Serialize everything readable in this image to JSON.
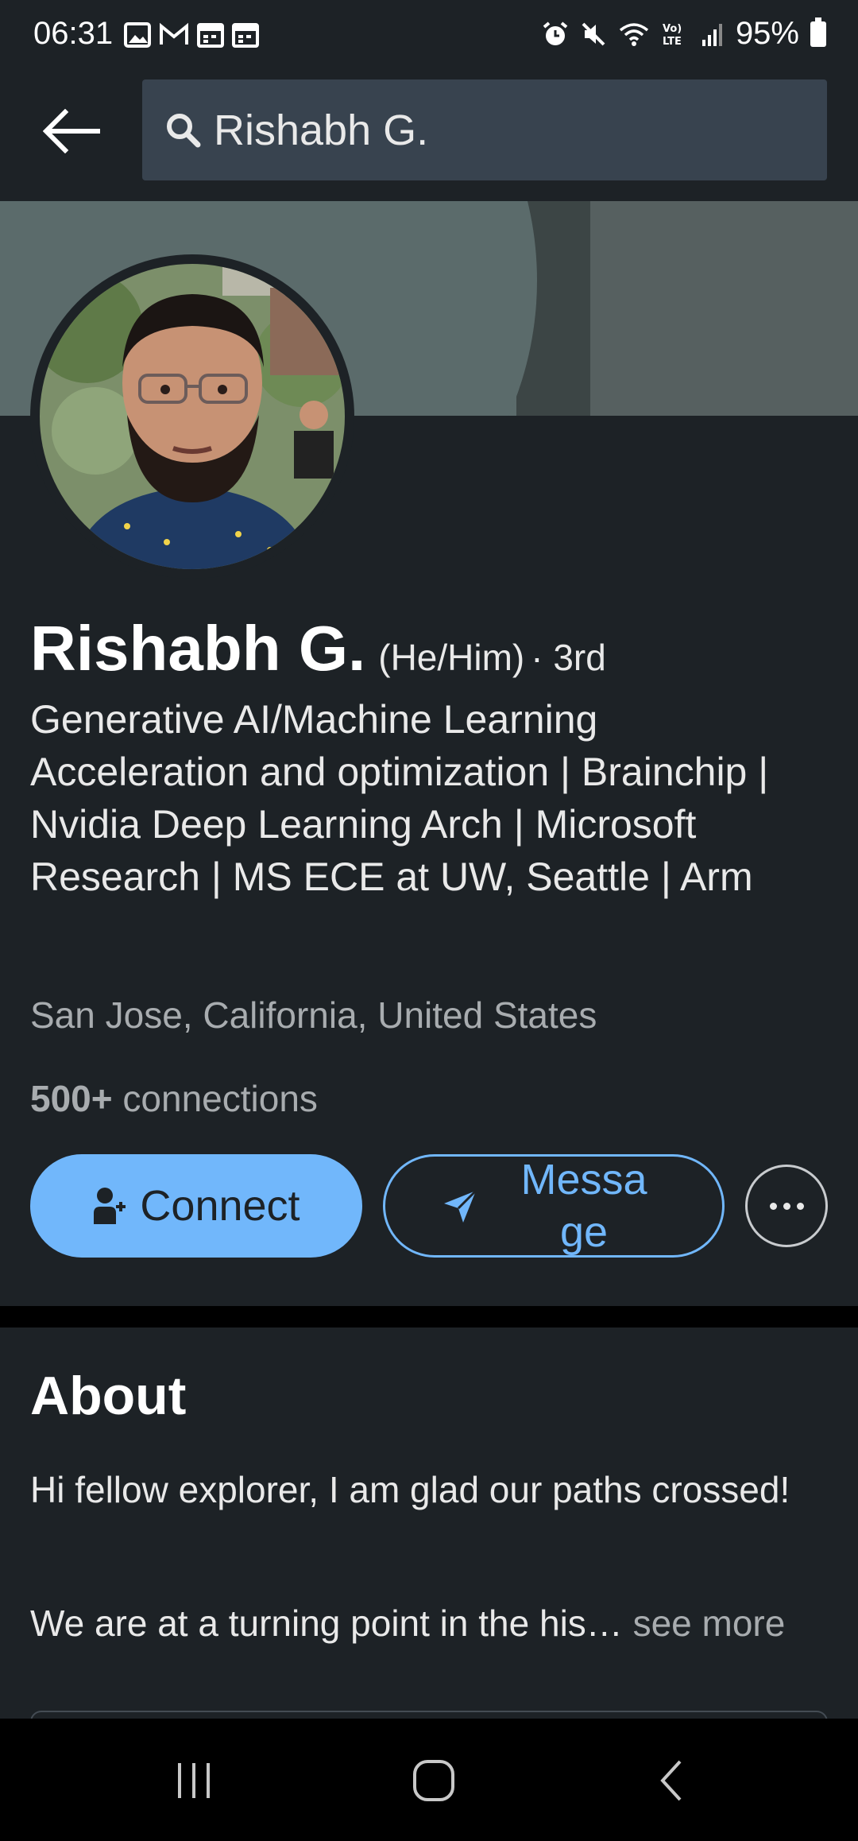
{
  "status_bar": {
    "time": "06:31",
    "battery": "95%",
    "left_icons": [
      "gallery-icon",
      "gmail-icon",
      "calendar-icon",
      "calendar-icon"
    ],
    "right_icons": [
      "alarm-icon",
      "mute-icon",
      "wifi-icon",
      "volte-icon",
      "signal-icon",
      "battery-icon"
    ]
  },
  "search": {
    "value": "Rishabh G."
  },
  "profile": {
    "name": "Rishabh G.",
    "pronouns": "(He/Him)",
    "degree": "· 3rd",
    "headline": "Generative AI/Machine Learning Acceleration and optimization | Brainchip | Nvidia Deep Learning Arch | Microsoft Research | MS ECE at UW, Seattle | Arm",
    "location": "San Jose, California, United States",
    "connections_count": "500+",
    "connections_label": "connections"
  },
  "actions": {
    "connect_label": "Connect",
    "message_label": "Message",
    "more_icon": "more-horizontal-icon"
  },
  "about": {
    "title": "About",
    "paragraph1": "Hi fellow explorer, I am glad our paths crossed!",
    "paragraph2": "We are at a turning point in the his…",
    "see_more": "see more"
  },
  "nav": {
    "recents": "recents-icon",
    "home": "home-icon",
    "back": "back-icon"
  },
  "colors": {
    "background": "#1d2226",
    "accent": "#71b7fb",
    "search_bg": "#38434f",
    "secondary_text": "#a8acaf"
  }
}
